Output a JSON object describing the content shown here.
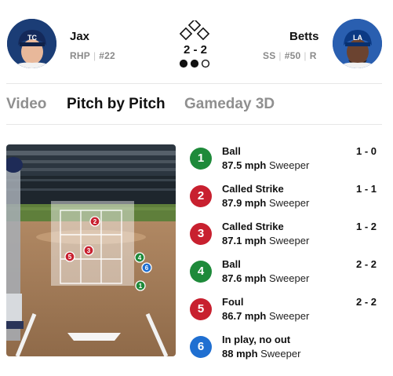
{
  "colors": {
    "ball": "#1e8a3a",
    "strike": "#c8202f",
    "in_play": "#1f6fd1"
  },
  "pitcher": {
    "name": "Jax",
    "position": "RHP",
    "number": "#22",
    "avatar_icon": "pitcher-headshot-avatar"
  },
  "batter": {
    "name": "Betts",
    "position": "SS",
    "number": "#50",
    "bats": "R",
    "avatar_icon": "batter-headshot-avatar"
  },
  "game_state": {
    "count": "2 - 2",
    "outs": 2,
    "outs_max": 3,
    "bases_icon": "bases-diamond-icon"
  },
  "tabs": [
    {
      "label": "Video",
      "active": false
    },
    {
      "label": "Pitch by Pitch",
      "active": true
    },
    {
      "label": "Gameday 3D",
      "active": false
    }
  ],
  "strike_zone": {
    "image_icon": "broadcast-strike-zone-view"
  },
  "pitches": [
    {
      "num": "1",
      "result": "Ball",
      "speed": "87.5 mph",
      "type": "Sweeper",
      "count": "1 - 0",
      "kind": "ball"
    },
    {
      "num": "2",
      "result": "Called Strike",
      "speed": "87.9 mph",
      "type": "Sweeper",
      "count": "1 - 1",
      "kind": "strike"
    },
    {
      "num": "3",
      "result": "Called Strike",
      "speed": "87.1 mph",
      "type": "Sweeper",
      "count": "1 - 2",
      "kind": "strike"
    },
    {
      "num": "4",
      "result": "Ball",
      "speed": "87.6 mph",
      "type": "Sweeper",
      "count": "2 - 2",
      "kind": "ball"
    },
    {
      "num": "5",
      "result": "Foul",
      "speed": "86.7 mph",
      "type": "Sweeper",
      "count": "2 - 2",
      "kind": "strike"
    },
    {
      "num": "6",
      "result": "In play, no out",
      "speed": "88 mph",
      "type": "Sweeper",
      "count": "",
      "kind": "in_play"
    }
  ]
}
